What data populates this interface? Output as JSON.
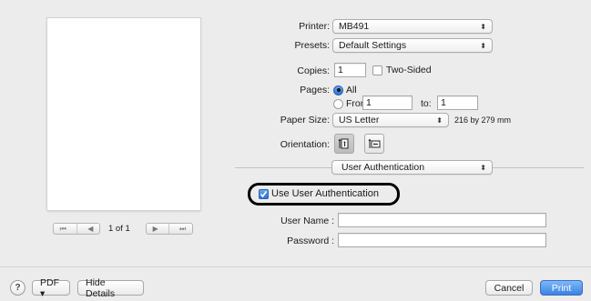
{
  "preview": {
    "page_count": "1 of 1",
    "first_btn": "⏮",
    "prev_btn": "◀",
    "next_btn": "▶",
    "last_btn": "⏭"
  },
  "printer": {
    "label": "Printer:",
    "value": "MB491"
  },
  "presets": {
    "label": "Presets:",
    "value": "Default Settings"
  },
  "copies": {
    "label": "Copies:",
    "value": "1",
    "two_sided_label": "Two-Sided",
    "two_sided_checked": false
  },
  "pages": {
    "label": "Pages:",
    "all_label": "All",
    "from_label": "From:",
    "from_value": "1",
    "to_label": "to:",
    "to_value": "1"
  },
  "paper_size": {
    "label": "Paper Size:",
    "value": "US Letter",
    "dimensions": "216 by 279 mm"
  },
  "orientation": {
    "label": "Orientation:",
    "selected": "portrait"
  },
  "section_menu": {
    "value": "User Authentication"
  },
  "auth": {
    "use_label": "Use User Authentication",
    "use_checked": true,
    "user_name_label": "User Name :",
    "user_name_value": "",
    "password_label": "Password :",
    "password_value": ""
  },
  "footer": {
    "help": "?",
    "pdf_label": "PDF ▾",
    "hide_details": "Hide Details",
    "cancel": "Cancel",
    "print": "Print"
  },
  "colors": {
    "accent": "#3b82e3",
    "window_bg": "#ececec"
  }
}
